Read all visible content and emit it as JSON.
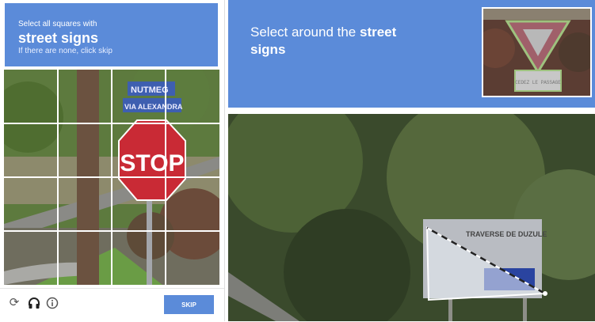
{
  "left_challenge": {
    "instruction_line1": "Select all squares with",
    "target": "street signs",
    "instruction_line3": "If there are none, click skip",
    "image_signs": {
      "street_sign_1": "NUTMEG",
      "street_sign_2": "VIA ALEXANDRA",
      "stop_sign": "STOP"
    },
    "grid_size": "4x4",
    "footer": {
      "icons": [
        "reload-icon",
        "headphones-icon",
        "info-icon"
      ],
      "skip_label": "SKIP"
    }
  },
  "right_challenge": {
    "instruction_prefix": "Select around the ",
    "instruction_bold": "street signs",
    "example_sign_text": "CEDEZ LE PASSAGE",
    "photo_sign_text": "TRAVERSE DE DUZULE"
  },
  "colors": {
    "header_blue": "#5b8bd9",
    "skip_blue": "#5b8bd9"
  }
}
